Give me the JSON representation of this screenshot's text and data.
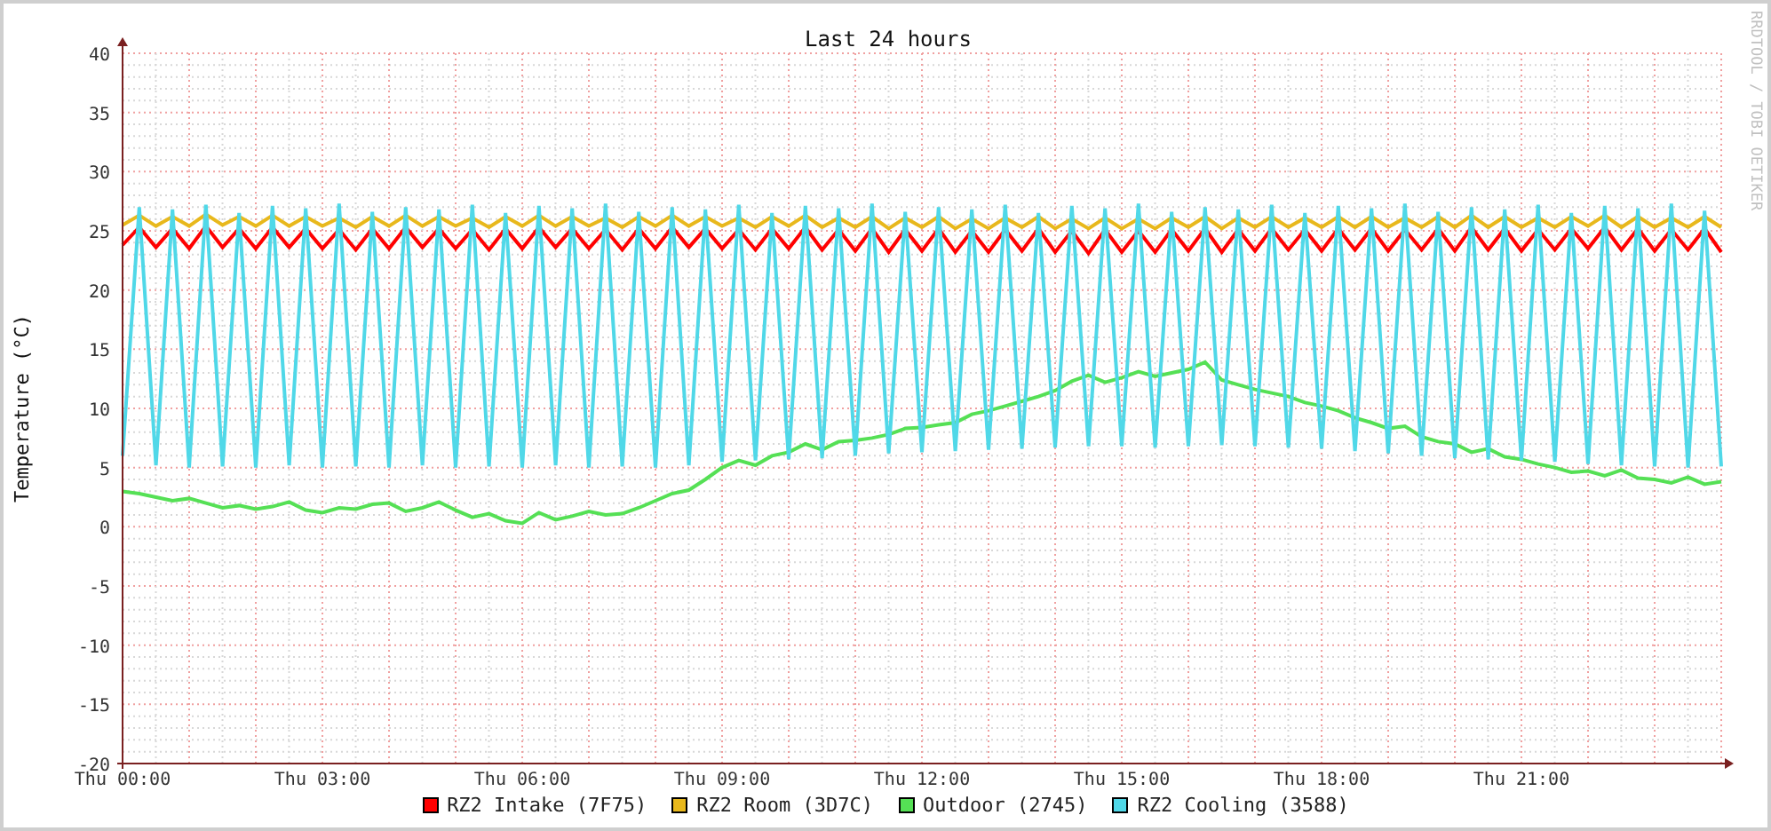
{
  "graph": {
    "title": "Last 24 hours",
    "credit": "RRDTOOL / TOBI OETIKER",
    "chart_data": {
      "type": "line",
      "ylabel": "Temperature (°C)",
      "ylim": [
        -20,
        40
      ],
      "grid": true,
      "yticks": [
        -20,
        -15,
        -10,
        -5,
        0,
        5,
        10,
        15,
        20,
        25,
        30,
        35,
        40
      ],
      "categories": [
        "Thu 00:00",
        null,
        null,
        null,
        null,
        null,
        null,
        null,
        null,
        null,
        null,
        null,
        "Thu 03:00",
        null,
        null,
        null,
        null,
        null,
        null,
        null,
        null,
        null,
        null,
        null,
        "Thu 06:00",
        null,
        null,
        null,
        null,
        null,
        null,
        null,
        null,
        null,
        null,
        null,
        "Thu 09:00",
        null,
        null,
        null,
        null,
        null,
        null,
        null,
        null,
        null,
        null,
        null,
        "Thu 12:00",
        null,
        null,
        null,
        null,
        null,
        null,
        null,
        null,
        null,
        null,
        null,
        "Thu 15:00",
        null,
        null,
        null,
        null,
        null,
        null,
        null,
        null,
        null,
        null,
        null,
        "Thu 18:00",
        null,
        null,
        null,
        null,
        null,
        null,
        null,
        null,
        null,
        null,
        null,
        "Thu 21:00",
        null,
        null,
        null,
        null,
        null,
        null,
        null,
        null,
        null,
        null,
        null,
        null
      ],
      "series": [
        {
          "name": "RZ2 Intake (7F75)",
          "color": "#ff0000",
          "values": [
            23.8,
            25.3,
            23.6,
            25.2,
            23.5,
            25.4,
            23.6,
            25.2,
            23.5,
            25.3,
            23.6,
            25.2,
            23.5,
            25.1,
            23.4,
            25.2,
            23.5,
            25.3,
            23.6,
            25.2,
            23.5,
            25.1,
            23.4,
            25.2,
            23.5,
            25.3,
            23.6,
            25.2,
            23.5,
            25.1,
            23.4,
            25.2,
            23.5,
            25.3,
            23.6,
            25.2,
            23.5,
            25.1,
            23.4,
            25.2,
            23.5,
            25.3,
            23.4,
            25.1,
            23.3,
            25.2,
            23.2,
            25.1,
            23.3,
            25.2,
            23.2,
            25.0,
            23.2,
            25.1,
            23.3,
            25.2,
            23.2,
            25.0,
            23.1,
            25.1,
            23.2,
            25.0,
            23.2,
            25.1,
            23.3,
            25.2,
            23.2,
            25.1,
            23.3,
            25.2,
            23.4,
            25.1,
            23.3,
            25.2,
            23.4,
            25.2,
            23.3,
            25.1,
            23.4,
            25.2,
            23.3,
            25.3,
            23.4,
            25.2,
            23.3,
            25.1,
            23.4,
            25.2,
            23.5,
            25.3,
            23.4,
            25.2,
            23.3,
            25.1,
            23.4,
            25.2,
            23.2
          ]
        },
        {
          "name": "RZ2 Room (3D7C)",
          "color": "#e8b81c",
          "values": [
            25.5,
            26.3,
            25.4,
            26.2,
            25.4,
            26.4,
            25.5,
            26.2,
            25.4,
            26.3,
            25.4,
            26.2,
            25.4,
            26.1,
            25.3,
            26.2,
            25.4,
            26.3,
            25.4,
            26.2,
            25.4,
            26.1,
            25.3,
            26.2,
            25.4,
            26.3,
            25.4,
            26.2,
            25.4,
            26.1,
            25.3,
            26.2,
            25.4,
            26.3,
            25.4,
            26.2,
            25.4,
            26.1,
            25.3,
            26.2,
            25.4,
            26.3,
            25.3,
            26.1,
            25.3,
            26.2,
            25.2,
            26.1,
            25.3,
            26.2,
            25.2,
            26.0,
            25.2,
            26.1,
            25.3,
            26.2,
            25.2,
            26.0,
            25.2,
            26.1,
            25.2,
            26.0,
            25.2,
            26.1,
            25.3,
            26.2,
            25.2,
            26.1,
            25.3,
            26.2,
            25.3,
            26.1,
            25.3,
            26.2,
            25.3,
            26.2,
            25.3,
            26.1,
            25.3,
            26.2,
            25.3,
            26.3,
            25.3,
            26.2,
            25.3,
            26.1,
            25.3,
            26.2,
            25.4,
            26.3,
            25.3,
            26.2,
            25.3,
            26.1,
            25.3,
            26.2,
            25.3
          ]
        },
        {
          "name": "Outdoor (2745)",
          "color": "#55e055",
          "values": [
            3.0,
            2.8,
            2.5,
            2.2,
            2.4,
            2.0,
            1.6,
            1.8,
            1.5,
            1.7,
            2.1,
            1.4,
            1.2,
            1.6,
            1.5,
            1.9,
            2.0,
            1.3,
            1.6,
            2.1,
            1.4,
            0.8,
            1.1,
            0.5,
            0.3,
            1.2,
            0.6,
            0.9,
            1.3,
            1.0,
            1.1,
            1.6,
            2.2,
            2.8,
            3.1,
            4.0,
            5.0,
            5.6,
            5.2,
            6.0,
            6.3,
            7.0,
            6.5,
            7.2,
            7.3,
            7.5,
            7.8,
            8.3,
            8.4,
            8.6,
            8.8,
            9.5,
            9.8,
            10.2,
            10.6,
            11.0,
            11.5,
            12.3,
            12.8,
            12.2,
            12.6,
            13.1,
            12.7,
            13.0,
            13.3,
            13.9,
            12.4,
            12.0,
            11.6,
            11.3,
            11.0,
            10.5,
            10.2,
            9.8,
            9.2,
            8.8,
            8.3,
            8.5,
            7.6,
            7.2,
            7.0,
            6.3,
            6.6,
            5.9,
            5.7,
            5.3,
            5.0,
            4.6,
            4.7,
            4.3,
            4.8,
            4.1,
            4.0,
            3.7,
            4.2,
            3.6,
            3.8
          ]
        },
        {
          "name": "RZ2 Cooling (3588)",
          "color": "#50d8e8",
          "values": [
            6.0,
            27.0,
            5.2,
            26.8,
            5.0,
            27.2,
            5.1,
            26.5,
            5.0,
            27.1,
            5.2,
            26.9,
            5.0,
            27.3,
            5.1,
            26.6,
            5.0,
            27.0,
            5.2,
            26.8,
            5.0,
            27.2,
            5.1,
            26.5,
            5.0,
            27.1,
            5.2,
            26.9,
            5.0,
            27.3,
            5.1,
            26.6,
            5.0,
            27.0,
            5.2,
            26.8,
            5.5,
            27.2,
            5.6,
            26.5,
            5.7,
            27.1,
            5.8,
            26.9,
            6.0,
            27.3,
            6.2,
            26.6,
            6.3,
            27.0,
            6.4,
            26.8,
            6.5,
            27.2,
            6.6,
            26.5,
            6.7,
            27.1,
            6.8,
            26.9,
            6.8,
            27.3,
            6.7,
            26.6,
            6.8,
            27.0,
            6.9,
            26.8,
            6.8,
            27.2,
            6.7,
            26.5,
            6.6,
            27.1,
            6.4,
            26.9,
            6.2,
            27.3,
            6.0,
            26.6,
            5.8,
            27.0,
            5.7,
            26.8,
            5.6,
            27.2,
            5.5,
            26.5,
            5.3,
            27.1,
            5.2,
            26.9,
            5.1,
            27.3,
            5.0,
            26.7,
            5.1
          ]
        }
      ]
    }
  }
}
